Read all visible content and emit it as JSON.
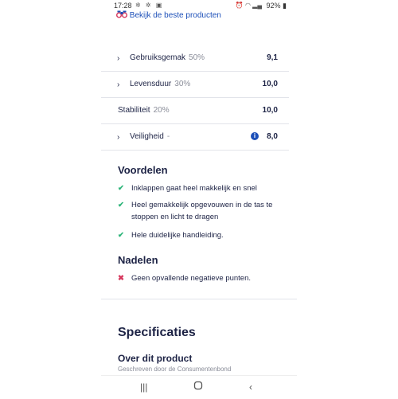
{
  "status_bar": {
    "time": "17:28",
    "battery": "92%"
  },
  "top_link": {
    "label": "Bekijk de beste producten"
  },
  "ratings": [
    {
      "label": "Gebruiksgemak",
      "weight": "50%",
      "score": "9,1",
      "expandable": true
    },
    {
      "label": "Levensduur",
      "weight": "30%",
      "score": "10,0",
      "expandable": true
    },
    {
      "label": "Stabiliteit",
      "weight": "20%",
      "score": "10,0",
      "expandable": false
    },
    {
      "label": "Veiligheid",
      "weight": "-",
      "score": "8,0",
      "expandable": true,
      "info": true
    }
  ],
  "pros": {
    "heading": "Voordelen",
    "items": [
      "Inklappen gaat heel makkelijk en snel",
      "Heel gemakkelijk opgevouwen in de tas te stoppen en licht te dragen",
      "Hele duidelijke handleiding."
    ]
  },
  "cons": {
    "heading": "Nadelen",
    "items": [
      "Geen opvallende negatieve punten."
    ]
  },
  "specs": {
    "title": "Specificaties",
    "about_title": "Over dit product",
    "about_subtitle": "Geschreven door de Consumentenbond"
  },
  "colors": {
    "text": "#1d2345",
    "link": "#1c4fb8",
    "check": "#2fb57a",
    "cross": "#d6365c"
  }
}
